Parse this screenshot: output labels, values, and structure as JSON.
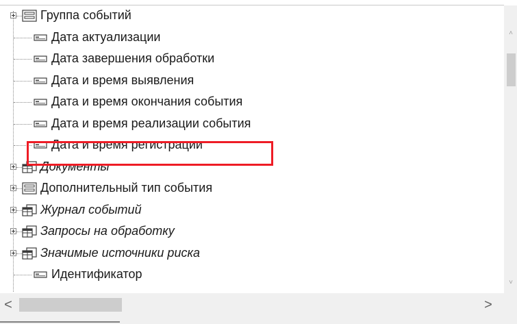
{
  "tree": {
    "items": [
      {
        "label": "Группа событий",
        "icon": "group-folder-icon",
        "expandable": true,
        "italic": false
      },
      {
        "label": "Дата актуализации",
        "icon": "attribute-icon",
        "expandable": false,
        "italic": false
      },
      {
        "label": "Дата завершения обработки",
        "icon": "attribute-icon",
        "expandable": false,
        "italic": false
      },
      {
        "label": "Дата и время выявления",
        "icon": "attribute-icon",
        "expandable": false,
        "italic": false
      },
      {
        "label": "Дата и время окончания события",
        "icon": "attribute-icon",
        "expandable": false,
        "italic": false
      },
      {
        "label": "Дата и время реализации события",
        "icon": "attribute-icon",
        "expandable": false,
        "italic": false
      },
      {
        "label": "Дата и время регистрации",
        "icon": "attribute-icon",
        "expandable": false,
        "italic": false,
        "highlighted": true
      },
      {
        "label": "Документы",
        "icon": "tabular-section-icon",
        "expandable": true,
        "italic": true
      },
      {
        "label": "Дополнительный тип события",
        "icon": "group-folder-icon",
        "expandable": true,
        "italic": false
      },
      {
        "label": "Журнал событий",
        "icon": "tabular-section-icon",
        "expandable": true,
        "italic": true
      },
      {
        "label": "Запросы на обработку",
        "icon": "tabular-section-icon",
        "expandable": true,
        "italic": true
      },
      {
        "label": "Значимые источники риска",
        "icon": "tabular-section-icon",
        "expandable": true,
        "italic": true
      },
      {
        "label": "Идентификатор",
        "icon": "attribute-icon",
        "expandable": false,
        "italic": false
      }
    ]
  },
  "scrollbars": {
    "vertical": {
      "up": "˄",
      "down": "˅"
    },
    "horizontal": {
      "left": "<",
      "right": ">"
    }
  },
  "colors": {
    "highlight": "#ee1c25",
    "background": "#ffffff",
    "scrollbar_track": "#f0f0f0"
  }
}
